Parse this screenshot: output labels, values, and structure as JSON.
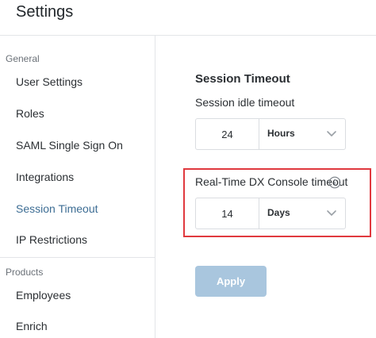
{
  "header": {
    "title": "Settings"
  },
  "sidebar": {
    "sections": [
      {
        "label": "General",
        "items": [
          {
            "label": "User Settings"
          },
          {
            "label": "Roles"
          },
          {
            "label": "SAML Single Sign On"
          },
          {
            "label": "Integrations"
          },
          {
            "label": "Session Timeout",
            "active": true
          },
          {
            "label": "IP Restrictions"
          }
        ]
      },
      {
        "label": "Products",
        "items": [
          {
            "label": "Employees"
          },
          {
            "label": "Enrich"
          }
        ]
      }
    ]
  },
  "main": {
    "title": "Session Timeout",
    "idle": {
      "label": "Session idle timeout",
      "value": "24",
      "unit": "Hours"
    },
    "console": {
      "label": "Real-Time DX Console timeout",
      "value": "14",
      "unit": "Days"
    },
    "apply_label": "Apply"
  },
  "colors": {
    "active_nav": "#3d6d94",
    "highlight": "#e0393e",
    "apply_disabled": "#a9c6de"
  },
  "icons": {
    "chevron": "chevron-down-icon",
    "info": "info-icon"
  }
}
